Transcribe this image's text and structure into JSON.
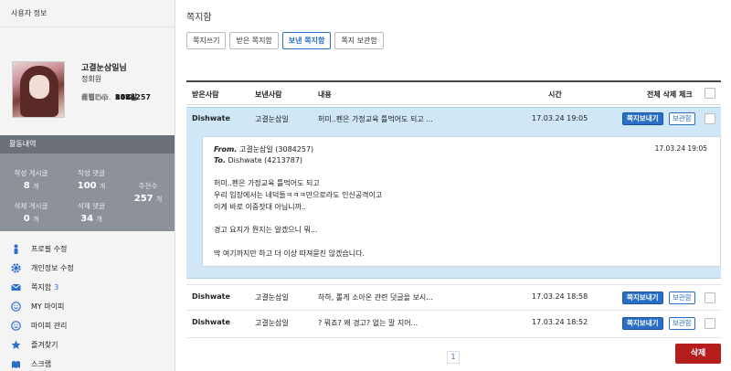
{
  "sidebar": {
    "header": "사용자 정보",
    "nickname": "고결눈삼일님",
    "grade": "정회원",
    "stats": [
      {
        "label": "회원번호",
        "value": "3084257",
        "red": false
      },
      {
        "label": "레벨",
        "value": "9",
        "red": true
      },
      {
        "label": "레벨Exp.",
        "value": "80%",
        "red": false
      },
      {
        "label": "필요Exp.",
        "value": "142",
        "red": false
      },
      {
        "label": "출석",
        "value": "157일",
        "red": false
      }
    ],
    "activity_header": "활동내역",
    "activity": {
      "posts_label": "작성 게시글",
      "posts_value": "8",
      "posts_unit": "개",
      "comments_label": "작성 댓글",
      "comments_value": "100",
      "comments_unit": "개",
      "likes_label": "추천수",
      "likes_value": "257",
      "likes_unit": "개",
      "del_posts_label": "삭제 게시글",
      "del_posts_value": "0",
      "del_posts_unit": "개",
      "del_comments_label": "삭제 댓글",
      "del_comments_value": "34",
      "del_comments_unit": "개"
    },
    "menu": [
      {
        "label": "프로필 수정",
        "icon": "person-icon",
        "badge": ""
      },
      {
        "label": "개인정보 수정",
        "icon": "gear-icon",
        "badge": ""
      },
      {
        "label": "쪽지함",
        "icon": "envelope-icon",
        "badge": "3"
      },
      {
        "label": "MY 마이피",
        "icon": "smiley-icon",
        "badge": ""
      },
      {
        "label": "마이피 관리",
        "icon": "smiley-icon",
        "badge": ""
      },
      {
        "label": "즐겨찾기",
        "icon": "star-icon",
        "badge": ""
      },
      {
        "label": "스크랩",
        "icon": "scrap-icon",
        "badge": ""
      }
    ]
  },
  "main": {
    "title": "쪽지함",
    "tabs": [
      "쪽지쓰기",
      "받은 쪽지함",
      "보낸 쪽지함",
      "쪽지 보관함"
    ],
    "active_tab": 2,
    "columns": {
      "recipient": "받은사람",
      "sender": "보낸사람",
      "content": "내용",
      "time": "시간",
      "select_all": "전체 삭제 체크"
    },
    "send_label": "쪽지보내기",
    "store_label": "보관함",
    "rows": [
      {
        "recipient": "Dishwate",
        "sender": "고결눈삼일",
        "content": "허미..펜은 가정교육 틀먹어도 되고 ...",
        "time": "17.03.24 19:05"
      },
      {
        "recipient": "Dishwate",
        "sender": "고결눈삼일",
        "content": "하하, 롤게 소아온 관련 덧글을 보시...",
        "time": "17.03.24 18:58"
      },
      {
        "recipient": "Dishwate",
        "sender": "고결눈삼일",
        "content": "? 뭐죠? 왜 경고? 없는 말 지어...",
        "time": "17.03.24 18:52"
      }
    ],
    "detail": {
      "from_label": "From.",
      "from_value": "고결눈삼일 (3084257)",
      "to_label": "To.",
      "to_value": "Dishwate (4213787)",
      "datetime": "17.03.24 19:05",
      "body": "허미..펜은 가정교육 틀먹어도 되고\n우리 입장에서는 네덕들ㅋㅋㅋ만으로라도 인신공격이고\n이게 바로 이중잣대 아닙니까..\n\n경고 요지가 뭔지는 알겠으니 뭐...\n\n딱 여기까지만 하고 더 이상 따져묻진 않겠습니다."
    },
    "page": "1",
    "delete_label": "삭제"
  }
}
